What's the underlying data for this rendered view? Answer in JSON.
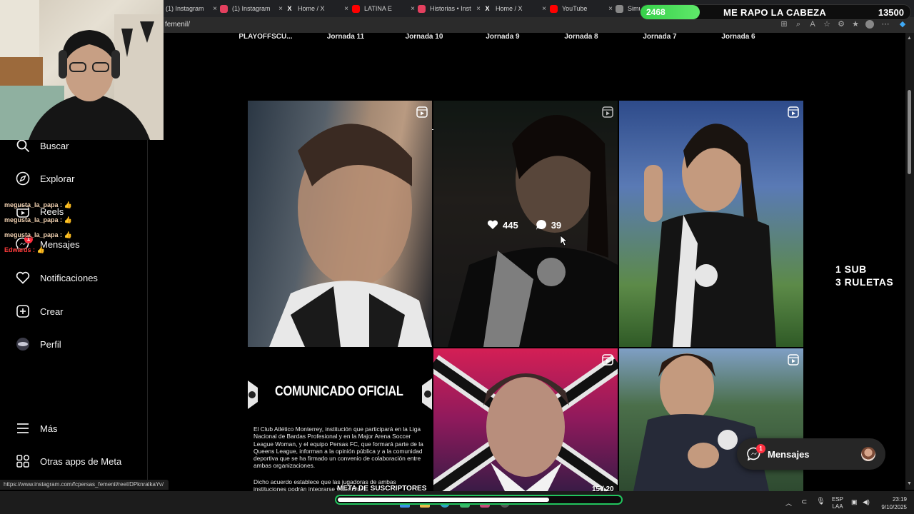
{
  "browser": {
    "tabs": [
      {
        "title": "(1) Instagram",
        "icon": "instagram-icon",
        "color": "#e4405f"
      },
      {
        "title": "(1) Instagram",
        "icon": "instagram-icon",
        "color": "#e4405f"
      },
      {
        "title": "Home / X",
        "icon": "x-icon",
        "color": "#ffffff"
      },
      {
        "title": "LATINA E",
        "icon": "youtube-icon",
        "color": "#ff0000"
      },
      {
        "title": "Historias • Inst",
        "icon": "instagram-icon",
        "color": "#e4405f"
      },
      {
        "title": "Home / X",
        "icon": "x-icon",
        "color": "#ffffff"
      },
      {
        "title": "YouTube",
        "icon": "youtube-icon",
        "color": "#ff0000"
      },
      {
        "title": "Simu",
        "icon": "globe-icon",
        "color": "#888888"
      }
    ],
    "url": "femenil/",
    "status_url": "https://www.instagram.com/fcpersas_femenil/reel/DPknralkaYv/"
  },
  "stream_overlay": {
    "counter": "2468",
    "counter_progress": 0.22,
    "meter_title": "ME RAPO LA CABEZA",
    "meter_goal": "13500",
    "chat": [
      {
        "user": "megusta_la_papa :",
        "color": "#f0d0b0"
      },
      {
        "user": "megusta_la_papa :",
        "color": "#f0d0b0"
      },
      {
        "user": "megusta_la_papa :",
        "color": "#f0d0b0"
      },
      {
        "user": "Edwards :",
        "color": "#ff3b3b"
      }
    ],
    "promo_line1": "1 SUB",
    "promo_line2": "3 RULETAS",
    "goal_label": "META DE SUSCRIPTORES",
    "goal_count": "15 / 20",
    "goal_progress": 0.75
  },
  "sidebar": {
    "items": [
      {
        "label": "Buscar",
        "icon": "search-icon"
      },
      {
        "label": "Explorar",
        "icon": "compass-icon"
      },
      {
        "label": "Reels",
        "icon": "reels-icon"
      },
      {
        "label": "Mensajes",
        "icon": "messenger-icon",
        "badge": "1"
      },
      {
        "label": "Notificaciones",
        "icon": "heart-icon"
      },
      {
        "label": "Crear",
        "icon": "plus-square-icon"
      },
      {
        "label": "Perfil",
        "icon": "avatar-icon"
      }
    ],
    "more": "Más",
    "meta_apps": "Otras apps de Meta"
  },
  "profile": {
    "highlights": [
      "PLAYOFFSCU...",
      "Jornada 11",
      "Jornada 10",
      "Jornada 9",
      "Jornada 8",
      "Jornada 7",
      "Jornada 6"
    ],
    "tabs": [
      "grid-icon",
      "reels-tab-icon",
      "tagged-icon"
    ],
    "hover_post": {
      "likes": "445",
      "comments": "39"
    },
    "announcement": {
      "title": "COMUNICADO OFICIAL",
      "body": "El Club Atlético Monterrey, institución que participará en la Liga Nacional de Bardas Profesional y en la Major Arena Soccer League Woman, y el equipo Persas FC, que formará parte de la Queens League, informan a la opinión pública y a la comunidad deportiva que se ha firmado un convenio de colaboración entre ambas organizaciones.",
      "body2": "Dicho acuerdo establece que las jugadoras de ambas instituciones podrán integrarse y participar"
    }
  },
  "messages_float": {
    "label": "Mensajes",
    "badge": "1"
  },
  "taskbar": {
    "lang": "ESP",
    "lang2": "LAA",
    "time": "23:19",
    "date": "9/10/2025"
  }
}
